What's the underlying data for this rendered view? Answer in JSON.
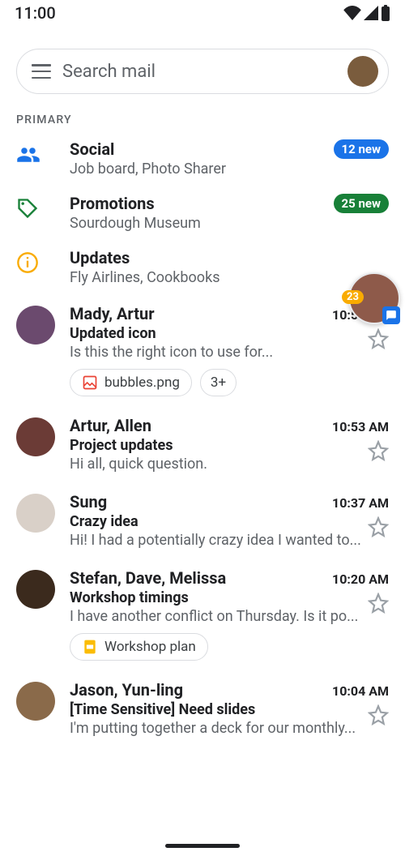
{
  "status": {
    "time": "11:00"
  },
  "search": {
    "placeholder": "Search mail"
  },
  "section_label": "PRIMARY",
  "categories": [
    {
      "id": "social",
      "title": "Social",
      "sub": "Job board, Photo Sharer",
      "badge": "12 new",
      "badge_color": "blue"
    },
    {
      "id": "promotions",
      "title": "Promotions",
      "sub": "Sourdough Museum",
      "badge": "25 new",
      "badge_color": "green"
    },
    {
      "id": "updates",
      "title": "Updates",
      "sub": "Fly Airlines, Cookbooks",
      "badge": "",
      "badge_color": ""
    }
  ],
  "floating": {
    "count": "23"
  },
  "emails": [
    {
      "sender": "Mady, Artur",
      "time": "10:55 AM",
      "subject": "Updated icon",
      "preview": "Is this the right icon to use for...",
      "avatar": "#6b4a6e",
      "chips": [
        {
          "icon": "image",
          "label": "bubbles.png"
        }
      ],
      "extra_chip": "3+"
    },
    {
      "sender": "Artur, Allen",
      "time": "10:53 AM",
      "subject": "Project updates",
      "preview": "Hi all, quick question.",
      "avatar": "#6b3b36"
    },
    {
      "sender": "Sung",
      "time": "10:37 AM",
      "subject": "Crazy idea",
      "preview": "Hi! I had a potentially crazy idea I wanted to...",
      "avatar": "#d9d0c8"
    },
    {
      "sender": "Stefan, Dave, Melissa",
      "time": "10:20 AM",
      "subject": "Workshop timings",
      "preview": "I have another conflict on Thursday. Is it po...",
      "avatar": "#3b2a1d",
      "chips": [
        {
          "icon": "slides",
          "label": "Workshop plan"
        }
      ]
    },
    {
      "sender": "Jason, Yun-ling",
      "time": "10:04 AM",
      "subject": "[Time Sensitive] Need slides",
      "preview": "I'm putting together a deck for our monthly...",
      "avatar": "#8a6a4a"
    }
  ]
}
